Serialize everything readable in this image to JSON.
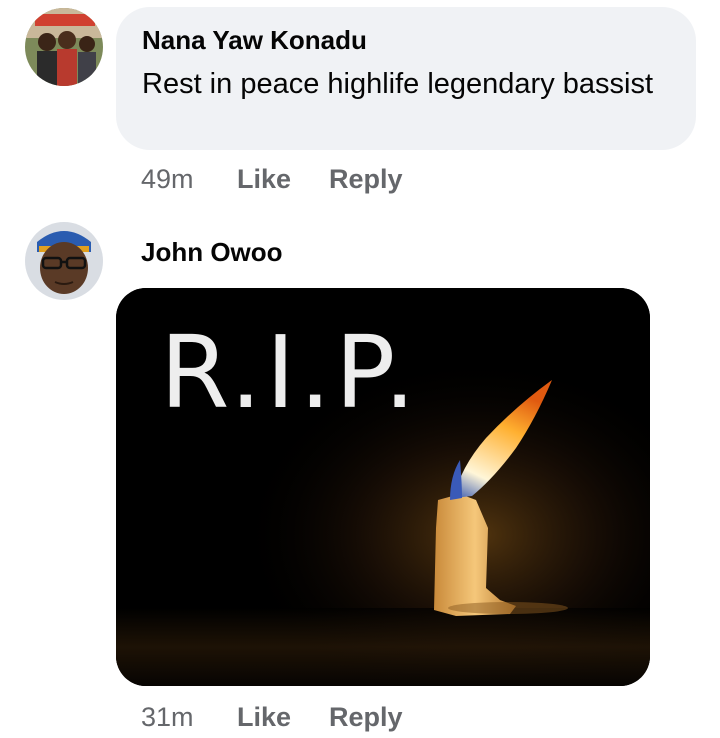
{
  "comments": [
    {
      "author": "Nana Yaw Konadu",
      "text": "Rest in peace highlife legendary bassist",
      "time": "49m",
      "like_label": "Like",
      "reply_label": "Reply"
    },
    {
      "author": "John Owoo",
      "image_text": "R.I.P.",
      "time": "31m",
      "like_label": "Like",
      "reply_label": "Reply"
    }
  ]
}
